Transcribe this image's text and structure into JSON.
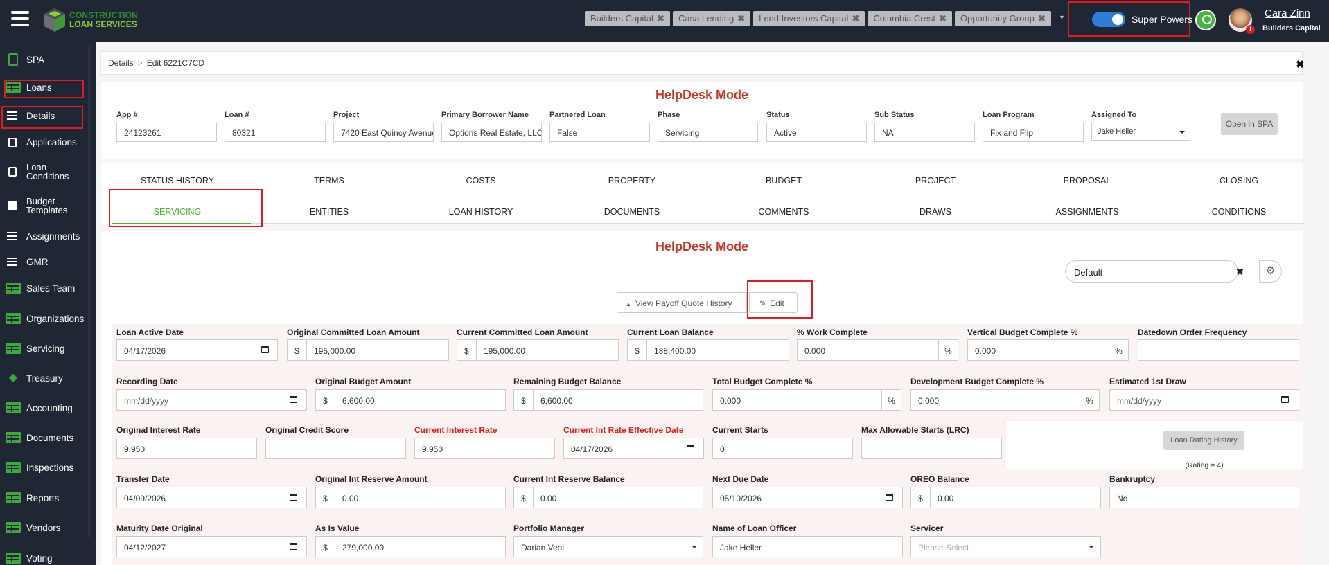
{
  "topbar": {
    "logo_line1": "CONSTRUCTION",
    "logo_line2": "LOAN SERVICES",
    "chips": [
      "Builders Capital",
      "Casa Lending",
      "Lend Investors Capital",
      "Columbia Crest",
      "Opportunity Group"
    ],
    "chip_close": "✖",
    "super_powers_label": "Super Powers",
    "super_powers_on": true,
    "notification_badge": "!",
    "user_name": "Cara Zinn",
    "user_company": "Builders Capital"
  },
  "sidebar": {
    "items": [
      "SPA",
      "Loans",
      "Details",
      "Applications",
      "Loan Conditions",
      "Budget Templates",
      "Assignments",
      "GMR",
      "Sales Team",
      "Organizations",
      "Servicing",
      "Treasury",
      "Accounting",
      "Documents",
      "Inspections",
      "Reports",
      "Vendors",
      "Voting"
    ]
  },
  "breadcrumb": {
    "root": "Details",
    "current": "Edit 6221C7CD",
    "sep": ">",
    "close": "✖"
  },
  "header_panel": {
    "mode_title": "HelpDesk Mode",
    "fields": [
      {
        "label": "App #",
        "value": "24123261"
      },
      {
        "label": "Loan #",
        "value": "80321"
      },
      {
        "label": "Project",
        "value": "7420 East Quincy Avenue"
      },
      {
        "label": "Primary Borrower Name",
        "value": "Options Real Estate, LLC"
      },
      {
        "label": "Partnered Loan",
        "value": "False"
      },
      {
        "label": "Phase",
        "value": "Servicing"
      },
      {
        "label": "Status",
        "value": "Active"
      },
      {
        "label": "Sub Status",
        "value": "NA"
      },
      {
        "label": "Loan Program",
        "value": "Fix and Flip"
      },
      {
        "label": "Assigned To",
        "value": "Jake Heller"
      }
    ],
    "open_spa": "Open in SPA"
  },
  "tabs": {
    "row1": [
      "STATUS HISTORY",
      "TERMS",
      "COSTS",
      "PROPERTY",
      "BUDGET",
      "PROJECT",
      "PROPOSAL",
      "CLOSING"
    ],
    "row2": [
      "SERVICING",
      "ENTITIES",
      "LOAN HISTORY",
      "DOCUMENTS",
      "COMMENTS",
      "DRAWS",
      "ASSIGNMENTS",
      "CONDITIONS"
    ],
    "active": "SERVICING"
  },
  "servicing": {
    "mode_title": "HelpDesk Mode",
    "view_select": "Default",
    "view_clear": "✖",
    "view_payoff": "View Payoff Quote History",
    "edit": "Edit",
    "currency": "$",
    "percent": "%",
    "loan_rating_btn": "Loan Rating History",
    "loan_rating": "(Rating = 4)",
    "row1": [
      {
        "label": "Loan Active Date",
        "value": "04/17/2026"
      },
      {
        "label": "Original Committed Loan Amount",
        "value": "195,000.00"
      },
      {
        "label": "Current Committed Loan Amount",
        "value": "195,000.00"
      },
      {
        "label": "Current Loan Balance",
        "value": "188,400.00"
      },
      {
        "label": "% Work Complete",
        "value": "0.000"
      },
      {
        "label": "Vertical Budget Complete %",
        "value": "0.000"
      },
      {
        "label": "Datedown Order Frequency",
        "value": ""
      }
    ],
    "row2": [
      {
        "label": "Recording Date",
        "value": "mm/dd/yyyy"
      },
      {
        "label": "Original Budget Amount",
        "value": "6,600.00"
      },
      {
        "label": "Remaining Budget Balance",
        "value": "6,600.00"
      },
      {
        "label": "Total Budget Complete %",
        "value": "0.000"
      },
      {
        "label": "Development Budget Complete %",
        "value": "0.000"
      },
      {
        "label": "Estimated 1st Draw",
        "value": "mm/dd/yyyy"
      }
    ],
    "row3": [
      {
        "label": "Original Interest Rate",
        "value": "9.950"
      },
      {
        "label": "Original Credit Score",
        "value": ""
      },
      {
        "label": "Current Interest Rate",
        "value": "9.950"
      },
      {
        "label": "Current Int Rate Effective Date",
        "value": "04/17/2026"
      },
      {
        "label": "Current Starts",
        "value": "0"
      },
      {
        "label": "Max Allowable Starts (LRC)",
        "value": ""
      }
    ],
    "row4": [
      {
        "label": "Transfer Date",
        "value": "04/09/2026"
      },
      {
        "label": "Original Int Reserve Amount",
        "value": "0.00"
      },
      {
        "label": "Current Int Reserve Balance",
        "value": "0.00"
      },
      {
        "label": "Next Due Date",
        "value": "05/10/2026"
      },
      {
        "label": "OREO Balance",
        "value": "0.00"
      },
      {
        "label": "Bankruptcy",
        "value": "No"
      }
    ],
    "row5": [
      {
        "label": "Maturity Date Original",
        "value": "04/12/2027"
      },
      {
        "label": "As Is Value",
        "value": "279,000.00"
      },
      {
        "label": "Portfolio Manager",
        "value": "Darian Veal"
      },
      {
        "label": "Name of Loan Officer",
        "value": "Jake Heller"
      },
      {
        "label": "Servicer",
        "value": "Please Select"
      }
    ]
  },
  "colors": {
    "accent_green": "#4caf2e",
    "helpdesk_red": "#c0392b",
    "highlight_red": "#e01b24",
    "topbar_bg": "#1f2634"
  }
}
